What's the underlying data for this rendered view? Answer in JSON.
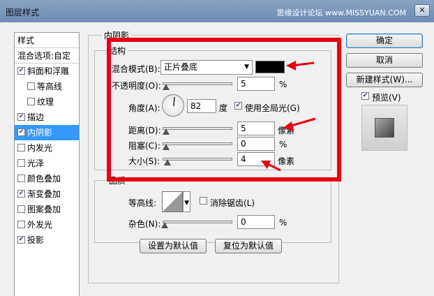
{
  "window": {
    "title": "图层样式",
    "watermark": "思缘设计论坛 www.MISSYUAN.COM",
    "close": "✕"
  },
  "sidebar": {
    "header": "样式",
    "blend_options": "混合选项:自定",
    "items": [
      {
        "label": "斜面和浮雕",
        "checked": true,
        "sub": false
      },
      {
        "label": "等高线",
        "checked": false,
        "sub": true
      },
      {
        "label": "纹理",
        "checked": false,
        "sub": true
      },
      {
        "label": "描边",
        "checked": true,
        "sub": false
      },
      {
        "label": "内阴影",
        "checked": true,
        "sub": false,
        "selected": true
      },
      {
        "label": "内发光",
        "checked": false,
        "sub": false
      },
      {
        "label": "光泽",
        "checked": false,
        "sub": false
      },
      {
        "label": "颜色叠加",
        "checked": false,
        "sub": false
      },
      {
        "label": "渐变叠加",
        "checked": true,
        "sub": false
      },
      {
        "label": "图案叠加",
        "checked": false,
        "sub": false
      },
      {
        "label": "外发光",
        "checked": false,
        "sub": false
      },
      {
        "label": "投影",
        "checked": true,
        "sub": false
      }
    ]
  },
  "panel": {
    "section_title": "内阴影",
    "structure": {
      "title": "结构",
      "blend_mode_label": "混合模式(B):",
      "blend_mode_value": "正片叠底",
      "swatch_color": "#000000",
      "opacity_label": "不透明度(O):",
      "opacity_value": "5",
      "opacity_unit": "%",
      "angle_label": "角度(A):",
      "angle_value": "82",
      "angle_unit": "度",
      "global_light_label": "使用全局光(G)",
      "global_light_checked": true,
      "distance_label": "距离(D):",
      "distance_value": "5",
      "distance_unit": "像素",
      "choke_label": "阻塞(C):",
      "choke_value": "0",
      "choke_unit": "%",
      "size_label": "大小(S):",
      "size_value": "4",
      "size_unit": "像素"
    },
    "quality": {
      "title": "品质",
      "contour_label": "等高线:",
      "antialias_label": "消除锯齿(L)",
      "antialias_checked": false,
      "noise_label": "杂色(N):",
      "noise_value": "0",
      "noise_unit": "%"
    },
    "set_default": "设置为默认值",
    "reset_default": "复位为默认值"
  },
  "buttons": {
    "ok": "确定",
    "cancel": "取消",
    "new_style": "新建样式(W)...",
    "preview": "预览(V)",
    "preview_checked": true
  },
  "annotation_color": "#e60012"
}
